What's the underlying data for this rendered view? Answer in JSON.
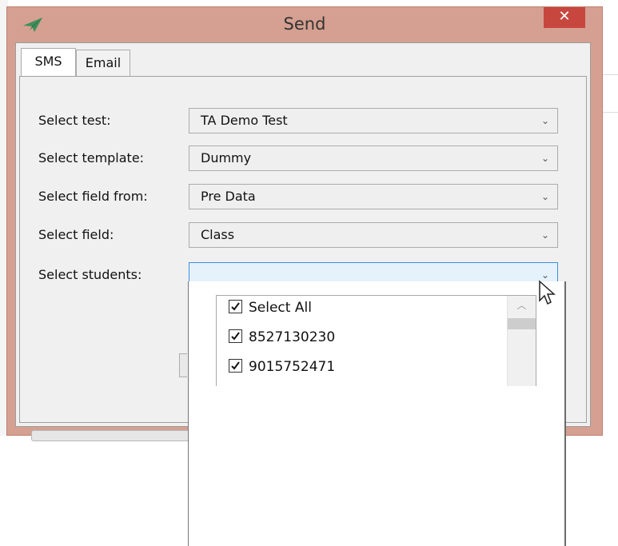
{
  "window": {
    "title": "Send",
    "close_glyph": "✕",
    "title_bar_color": "#d5a091",
    "close_button_color": "#c7463d",
    "app_icon": "paper-plane-icon"
  },
  "tabs": [
    {
      "label": "SMS",
      "selected": true
    },
    {
      "label": "Email",
      "selected": false
    }
  ],
  "form": {
    "rows": [
      {
        "label": "Select test:",
        "value": "TA Demo Test"
      },
      {
        "label": "Select template:",
        "value": "Dummy"
      },
      {
        "label": "Select field from:",
        "value": "Pre Data"
      },
      {
        "label": "Select field:",
        "value": "Class"
      },
      {
        "label": "Select students:",
        "value": ""
      }
    ],
    "dropdown_arrow": "⌄"
  },
  "students_dropdown": {
    "items": [
      {
        "label": "Select All",
        "checked": true
      },
      {
        "label": "8527130230",
        "checked": true
      },
      {
        "label": "9015752471",
        "checked": true
      }
    ],
    "scroll_up_glyph": "︿"
  }
}
